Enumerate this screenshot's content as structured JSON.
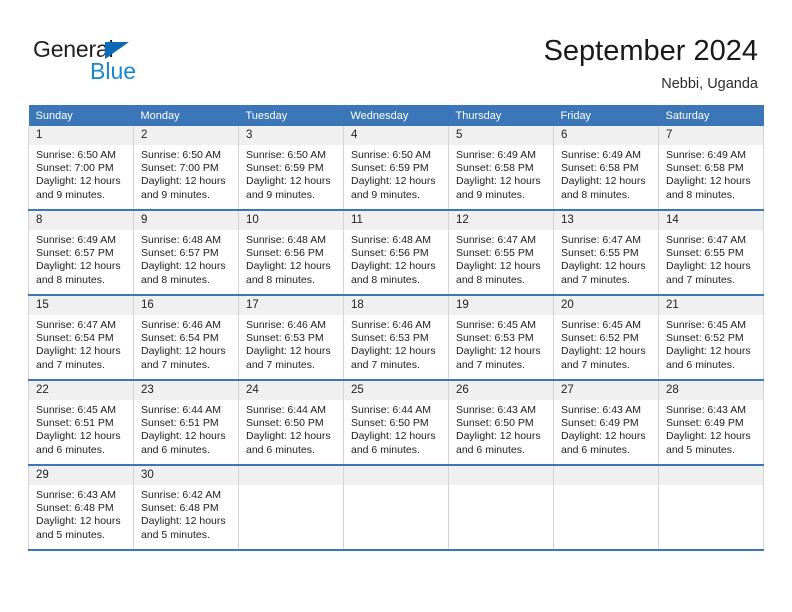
{
  "brand": {
    "name_top": "General",
    "name_bottom": "Blue",
    "accent_color": "#1b86d4",
    "triangle_color": "#0b6ab8"
  },
  "header": {
    "title": "September 2024",
    "location": "Nebbi, Uganda"
  },
  "theme": {
    "header_bg": "#3b77b8",
    "daynum_bg": "#f0f0f0",
    "cell_bg": "#ffffff",
    "border_color": "#d4d4d4"
  },
  "weekday_headers": [
    "Sunday",
    "Monday",
    "Tuesday",
    "Wednesday",
    "Thursday",
    "Friday",
    "Saturday"
  ],
  "weeks": [
    [
      {
        "day": "1",
        "sunrise": "Sunrise: 6:50 AM",
        "sunset": "Sunset: 7:00 PM",
        "daylight1": "Daylight: 12 hours",
        "daylight2": "and 9 minutes."
      },
      {
        "day": "2",
        "sunrise": "Sunrise: 6:50 AM",
        "sunset": "Sunset: 7:00 PM",
        "daylight1": "Daylight: 12 hours",
        "daylight2": "and 9 minutes."
      },
      {
        "day": "3",
        "sunrise": "Sunrise: 6:50 AM",
        "sunset": "Sunset: 6:59 PM",
        "daylight1": "Daylight: 12 hours",
        "daylight2": "and 9 minutes."
      },
      {
        "day": "4",
        "sunrise": "Sunrise: 6:50 AM",
        "sunset": "Sunset: 6:59 PM",
        "daylight1": "Daylight: 12 hours",
        "daylight2": "and 9 minutes."
      },
      {
        "day": "5",
        "sunrise": "Sunrise: 6:49 AM",
        "sunset": "Sunset: 6:58 PM",
        "daylight1": "Daylight: 12 hours",
        "daylight2": "and 9 minutes."
      },
      {
        "day": "6",
        "sunrise": "Sunrise: 6:49 AM",
        "sunset": "Sunset: 6:58 PM",
        "daylight1": "Daylight: 12 hours",
        "daylight2": "and 8 minutes."
      },
      {
        "day": "7",
        "sunrise": "Sunrise: 6:49 AM",
        "sunset": "Sunset: 6:58 PM",
        "daylight1": "Daylight: 12 hours",
        "daylight2": "and 8 minutes."
      }
    ],
    [
      {
        "day": "8",
        "sunrise": "Sunrise: 6:49 AM",
        "sunset": "Sunset: 6:57 PM",
        "daylight1": "Daylight: 12 hours",
        "daylight2": "and 8 minutes."
      },
      {
        "day": "9",
        "sunrise": "Sunrise: 6:48 AM",
        "sunset": "Sunset: 6:57 PM",
        "daylight1": "Daylight: 12 hours",
        "daylight2": "and 8 minutes."
      },
      {
        "day": "10",
        "sunrise": "Sunrise: 6:48 AM",
        "sunset": "Sunset: 6:56 PM",
        "daylight1": "Daylight: 12 hours",
        "daylight2": "and 8 minutes."
      },
      {
        "day": "11",
        "sunrise": "Sunrise: 6:48 AM",
        "sunset": "Sunset: 6:56 PM",
        "daylight1": "Daylight: 12 hours",
        "daylight2": "and 8 minutes."
      },
      {
        "day": "12",
        "sunrise": "Sunrise: 6:47 AM",
        "sunset": "Sunset: 6:55 PM",
        "daylight1": "Daylight: 12 hours",
        "daylight2": "and 8 minutes."
      },
      {
        "day": "13",
        "sunrise": "Sunrise: 6:47 AM",
        "sunset": "Sunset: 6:55 PM",
        "daylight1": "Daylight: 12 hours",
        "daylight2": "and 7 minutes."
      },
      {
        "day": "14",
        "sunrise": "Sunrise: 6:47 AM",
        "sunset": "Sunset: 6:55 PM",
        "daylight1": "Daylight: 12 hours",
        "daylight2": "and 7 minutes."
      }
    ],
    [
      {
        "day": "15",
        "sunrise": "Sunrise: 6:47 AM",
        "sunset": "Sunset: 6:54 PM",
        "daylight1": "Daylight: 12 hours",
        "daylight2": "and 7 minutes."
      },
      {
        "day": "16",
        "sunrise": "Sunrise: 6:46 AM",
        "sunset": "Sunset: 6:54 PM",
        "daylight1": "Daylight: 12 hours",
        "daylight2": "and 7 minutes."
      },
      {
        "day": "17",
        "sunrise": "Sunrise: 6:46 AM",
        "sunset": "Sunset: 6:53 PM",
        "daylight1": "Daylight: 12 hours",
        "daylight2": "and 7 minutes."
      },
      {
        "day": "18",
        "sunrise": "Sunrise: 6:46 AM",
        "sunset": "Sunset: 6:53 PM",
        "daylight1": "Daylight: 12 hours",
        "daylight2": "and 7 minutes."
      },
      {
        "day": "19",
        "sunrise": "Sunrise: 6:45 AM",
        "sunset": "Sunset: 6:53 PM",
        "daylight1": "Daylight: 12 hours",
        "daylight2": "and 7 minutes."
      },
      {
        "day": "20",
        "sunrise": "Sunrise: 6:45 AM",
        "sunset": "Sunset: 6:52 PM",
        "daylight1": "Daylight: 12 hours",
        "daylight2": "and 7 minutes."
      },
      {
        "day": "21",
        "sunrise": "Sunrise: 6:45 AM",
        "sunset": "Sunset: 6:52 PM",
        "daylight1": "Daylight: 12 hours",
        "daylight2": "and 6 minutes."
      }
    ],
    [
      {
        "day": "22",
        "sunrise": "Sunrise: 6:45 AM",
        "sunset": "Sunset: 6:51 PM",
        "daylight1": "Daylight: 12 hours",
        "daylight2": "and 6 minutes."
      },
      {
        "day": "23",
        "sunrise": "Sunrise: 6:44 AM",
        "sunset": "Sunset: 6:51 PM",
        "daylight1": "Daylight: 12 hours",
        "daylight2": "and 6 minutes."
      },
      {
        "day": "24",
        "sunrise": "Sunrise: 6:44 AM",
        "sunset": "Sunset: 6:50 PM",
        "daylight1": "Daylight: 12 hours",
        "daylight2": "and 6 minutes."
      },
      {
        "day": "25",
        "sunrise": "Sunrise: 6:44 AM",
        "sunset": "Sunset: 6:50 PM",
        "daylight1": "Daylight: 12 hours",
        "daylight2": "and 6 minutes."
      },
      {
        "day": "26",
        "sunrise": "Sunrise: 6:43 AM",
        "sunset": "Sunset: 6:50 PM",
        "daylight1": "Daylight: 12 hours",
        "daylight2": "and 6 minutes."
      },
      {
        "day": "27",
        "sunrise": "Sunrise: 6:43 AM",
        "sunset": "Sunset: 6:49 PM",
        "daylight1": "Daylight: 12 hours",
        "daylight2": "and 6 minutes."
      },
      {
        "day": "28",
        "sunrise": "Sunrise: 6:43 AM",
        "sunset": "Sunset: 6:49 PM",
        "daylight1": "Daylight: 12 hours",
        "daylight2": "and 5 minutes."
      }
    ],
    [
      {
        "day": "29",
        "sunrise": "Sunrise: 6:43 AM",
        "sunset": "Sunset: 6:48 PM",
        "daylight1": "Daylight: 12 hours",
        "daylight2": "and 5 minutes."
      },
      {
        "day": "30",
        "sunrise": "Sunrise: 6:42 AM",
        "sunset": "Sunset: 6:48 PM",
        "daylight1": "Daylight: 12 hours",
        "daylight2": "and 5 minutes."
      },
      {
        "day": "",
        "sunrise": "",
        "sunset": "",
        "daylight1": "",
        "daylight2": ""
      },
      {
        "day": "",
        "sunrise": "",
        "sunset": "",
        "daylight1": "",
        "daylight2": ""
      },
      {
        "day": "",
        "sunrise": "",
        "sunset": "",
        "daylight1": "",
        "daylight2": ""
      },
      {
        "day": "",
        "sunrise": "",
        "sunset": "",
        "daylight1": "",
        "daylight2": ""
      },
      {
        "day": "",
        "sunrise": "",
        "sunset": "",
        "daylight1": "",
        "daylight2": ""
      }
    ]
  ]
}
